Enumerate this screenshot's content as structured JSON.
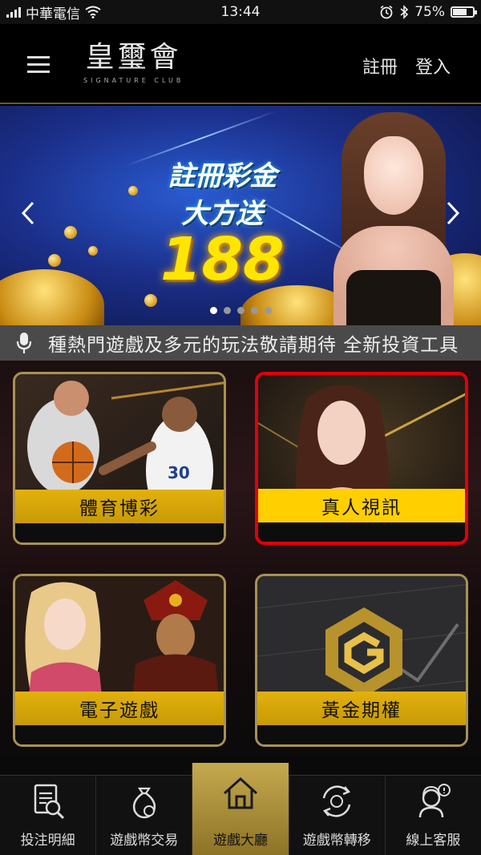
{
  "status_bar": {
    "carrier": "中華電信",
    "time": "13:44",
    "battery": "75%",
    "battery_level": 0.75
  },
  "header": {
    "logo_title": "皇璽會",
    "logo_subtitle": "SIGNATURE CLUB",
    "register_label": "註冊",
    "login_label": "登入"
  },
  "banner": {
    "line1": "註冊彩金",
    "line2": "大方送",
    "amount": "188",
    "slide_count": 5,
    "active_slide": 0,
    "prev_icon": "chevron-left-icon",
    "next_icon": "chevron-right-icon"
  },
  "marquee": {
    "icon": "microphone-icon",
    "text": "種熱門遊戲及多元的玩法敬請期待     全新投資工具"
  },
  "games": [
    {
      "label": "體育博彩"
    },
    {
      "label": "真人視訊"
    },
    {
      "label": "電子遊戲"
    },
    {
      "label": "黃金期權"
    }
  ],
  "tabbar": {
    "items": [
      {
        "label": "投注明細",
        "icon": "bet-receipt-icon"
      },
      {
        "label": "遊戲幣交易",
        "icon": "money-bag-icon"
      },
      {
        "label": "遊戲大廳",
        "icon": "home-icon"
      },
      {
        "label": "遊戲幣轉移",
        "icon": "transfer-coin-icon"
      },
      {
        "label": "線上客服",
        "icon": "customer-service-icon"
      }
    ],
    "active_index": 2
  },
  "colors": {
    "accent_gold": "#c8a23a",
    "selection_red": "#e0000a",
    "label_yellow": "#e2b10e"
  }
}
